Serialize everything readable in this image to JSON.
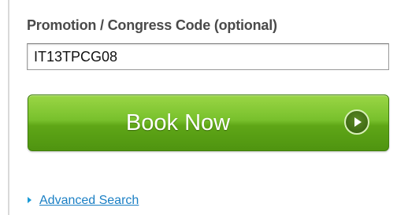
{
  "promo": {
    "label": "Promotion / Congress Code (optional)",
    "value": "IT13TPCG08"
  },
  "book_button": {
    "label": "Book Now",
    "icon": "play-circle-icon"
  },
  "advanced_search": {
    "label": "Advanced Search",
    "icon": "triangle-right-icon"
  },
  "colors": {
    "button_green": "#6bb521",
    "link_blue": "#1a7fc4",
    "label_gray": "#4a4a4a"
  }
}
